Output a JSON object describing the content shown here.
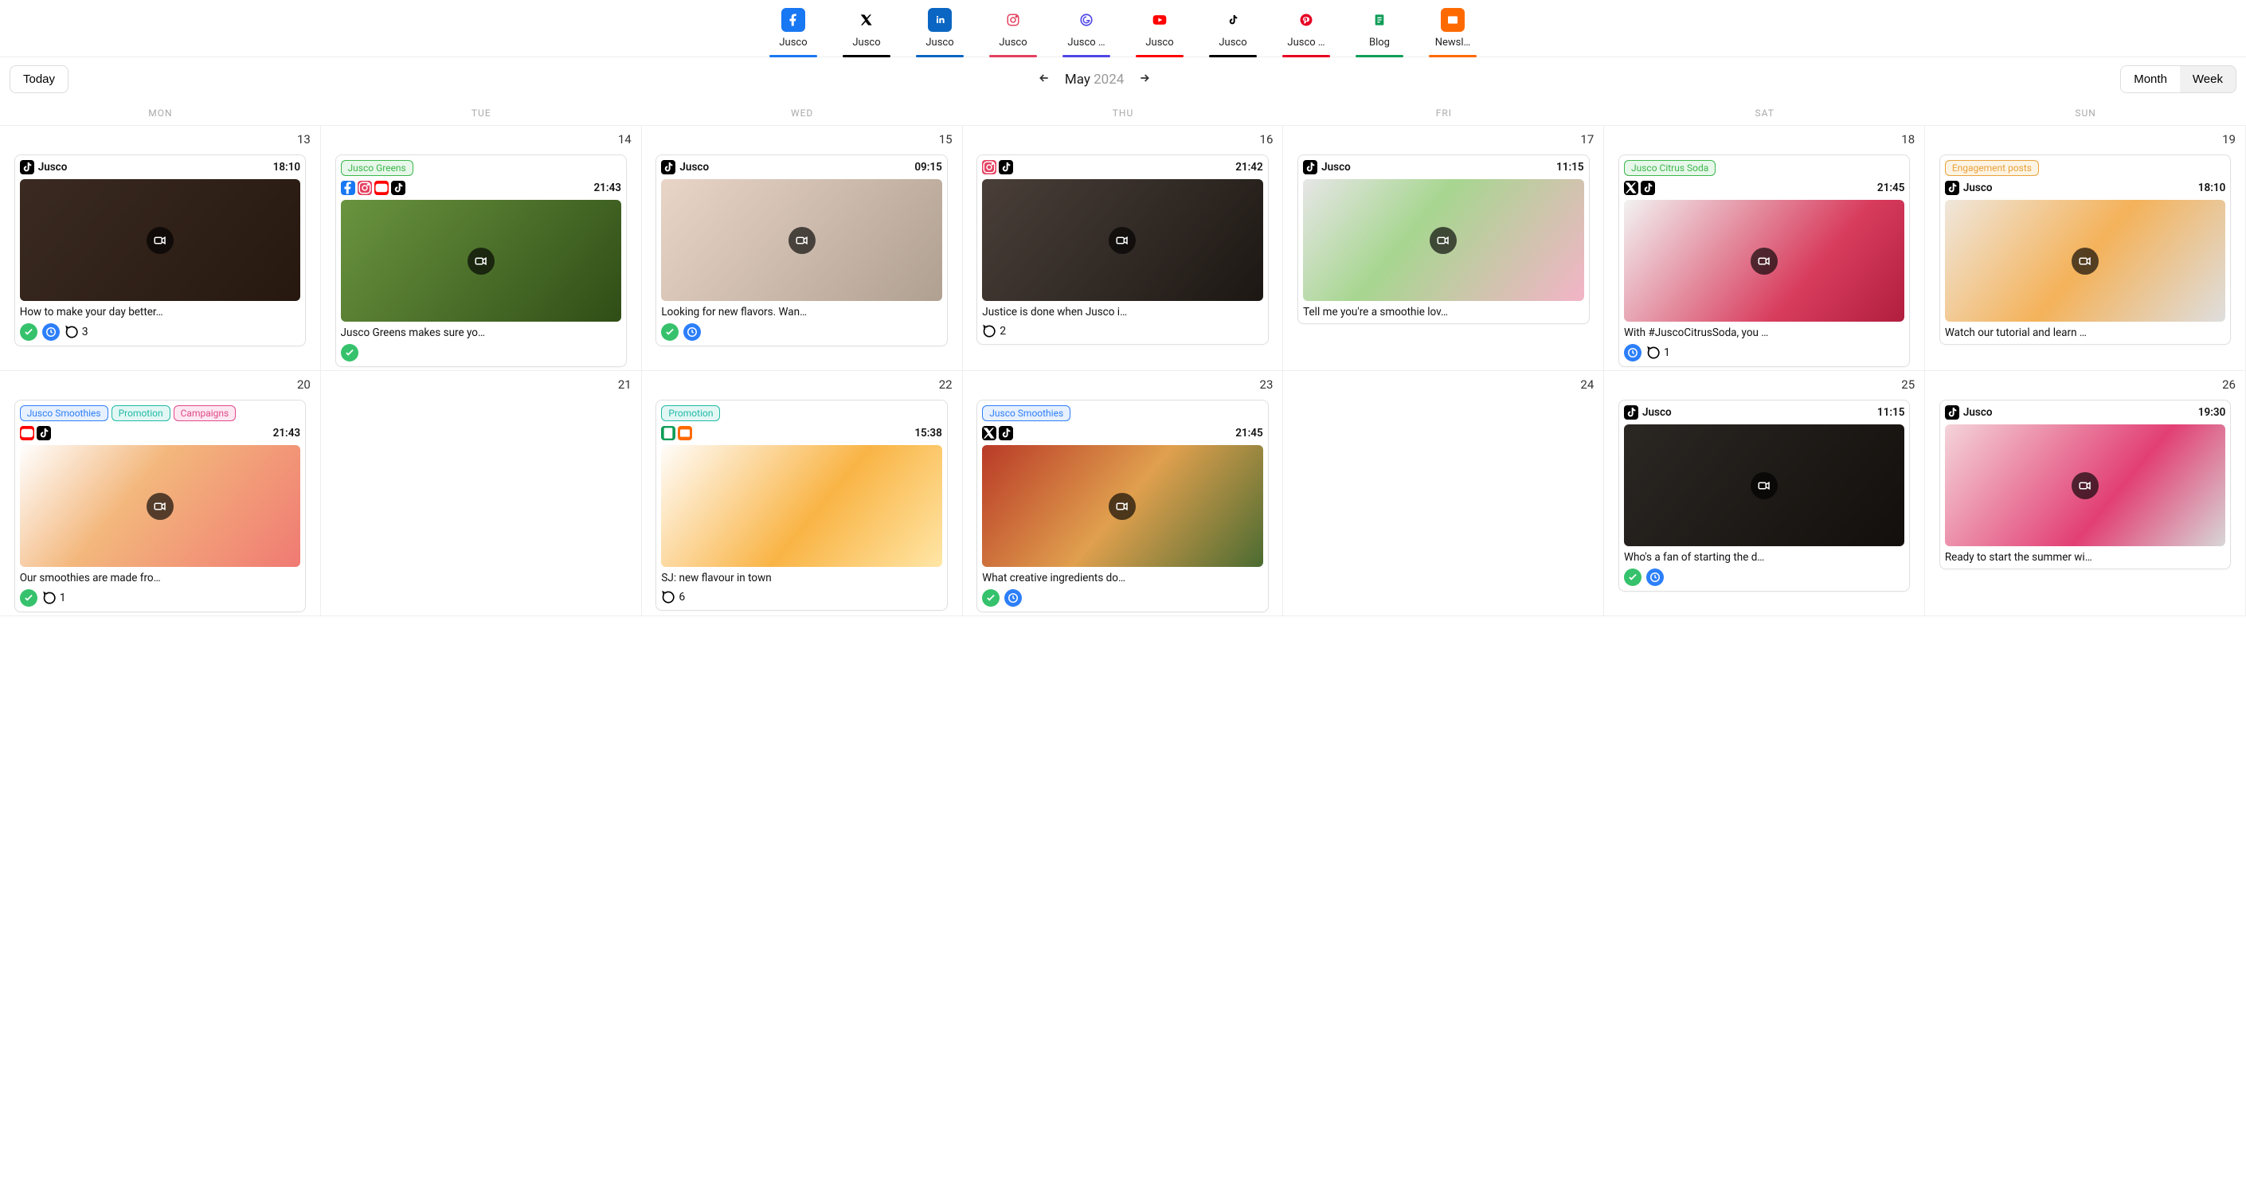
{
  "channels": [
    {
      "label": "Jusco",
      "icon": "facebook",
      "bg": "#1877F2",
      "fg": "#fff",
      "underline": "#1877F2"
    },
    {
      "label": "Jusco",
      "icon": "x",
      "bg": "#fff",
      "fg": "#000",
      "underline": "#000"
    },
    {
      "label": "Jusco",
      "icon": "linkedin",
      "bg": "#0A66C2",
      "fg": "#fff",
      "underline": "#0A66C2"
    },
    {
      "label": "Jusco",
      "icon": "instagram",
      "bg": "#fff",
      "fg": "#E4405F",
      "underline": "#E4405F"
    },
    {
      "label": "Jusco …",
      "icon": "google",
      "bg": "#fff",
      "fg": "#4F46E5",
      "underline": "#4F46E5"
    },
    {
      "label": "Jusco",
      "icon": "youtube",
      "bg": "#fff",
      "fg": "#FF0000",
      "underline": "#FF0000"
    },
    {
      "label": "Jusco",
      "icon": "tiktok",
      "bg": "#fff",
      "fg": "#000",
      "underline": "#000"
    },
    {
      "label": "Jusco …",
      "icon": "pinterest",
      "bg": "#fff",
      "fg": "#E60023",
      "underline": "#E60023"
    },
    {
      "label": "Blog",
      "icon": "doc",
      "bg": "#fff",
      "fg": "#0F9D58",
      "underline": "#0F9D58"
    },
    {
      "label": "Newsl…",
      "icon": "mail",
      "bg": "#FF6A00",
      "fg": "#fff",
      "underline": "#FF6A00"
    }
  ],
  "toolbar": {
    "today": "Today",
    "month": "May",
    "year": "2024",
    "view_month": "Month",
    "view_week": "Week"
  },
  "weekdays": [
    "MON",
    "TUE",
    "WED",
    "THU",
    "FRI",
    "SAT",
    "SUN"
  ],
  "week1_dates": [
    "13",
    "14",
    "15",
    "16",
    "17",
    "18",
    "19"
  ],
  "week2_dates": [
    "20",
    "21",
    "22",
    "23",
    "24",
    "25",
    "26"
  ],
  "tags": {
    "jusco_greens": {
      "label": "Jusco Greens",
      "color": "#3bb74b",
      "bg": "#e7f7ea"
    },
    "jusco_citrus": {
      "label": "Jusco Citrus Soda",
      "color": "#3bb74b",
      "bg": "#e7f7ea"
    },
    "engagement": {
      "label": "Engagement posts",
      "color": "#e9a13b",
      "bg": "#fdf4e3"
    },
    "jusco_smoothies": {
      "label": "Jusco Smoothies",
      "color": "#2d7ff9",
      "bg": "#e7f0fe"
    },
    "promotion": {
      "label": "Promotion",
      "color": "#20b9a7",
      "bg": "#e2f7f4"
    },
    "campaigns": {
      "label": "Campaigns",
      "color": "#e04a8a",
      "bg": "#fde7f1"
    }
  },
  "cards": {
    "c13": {
      "account": "Jusco",
      "channels": [
        "tiktok"
      ],
      "time": "18:10",
      "caption": "How to make your day better…",
      "thumb": "t-coffee",
      "video": true,
      "status": [
        "check",
        "clock"
      ],
      "comments": 3
    },
    "c14": {
      "tags": [
        "jusco_greens"
      ],
      "channels": [
        "facebook",
        "instagram",
        "youtube",
        "tiktok"
      ],
      "time": "21:43",
      "caption": "Jusco Greens makes sure yo…",
      "thumb": "t-green",
      "video": true,
      "status": [
        "check"
      ]
    },
    "c15": {
      "account": "Jusco",
      "channels": [
        "tiktok"
      ],
      "time": "09:15",
      "caption": "Looking for new flavors. Wan…",
      "thumb": "t-face",
      "video": true,
      "status": [
        "check",
        "clock"
      ]
    },
    "c16": {
      "channels": [
        "instagram",
        "tiktok"
      ],
      "time": "21:42",
      "caption": "Justice is done when Jusco i…",
      "thumb": "t-bar",
      "video": true,
      "comments": 2
    },
    "c17": {
      "account": "Jusco",
      "channels": [
        "tiktok"
      ],
      "time": "11:15",
      "caption": "Tell me you're a smoothie lov…",
      "thumb": "t-smoothie",
      "video": true
    },
    "c18": {
      "tags": [
        "jusco_citrus"
      ],
      "channels": [
        "x",
        "tiktok"
      ],
      "time": "21:45",
      "caption": "With #JuscoCitrusSoda, you …",
      "thumb": "t-citrus",
      "video": true,
      "status": [
        "clock"
      ],
      "comments": 1
    },
    "c19": {
      "tags": [
        "engagement"
      ],
      "account": "Jusco",
      "channels": [
        "tiktok"
      ],
      "time": "18:10",
      "caption": "Watch our tutorial and learn …",
      "thumb": "t-net",
      "video": true
    },
    "c20": {
      "tags": [
        "jusco_smoothies",
        "promotion",
        "campaigns"
      ],
      "channels": [
        "youtube",
        "tiktok"
      ],
      "time": "21:43",
      "caption": "Our smoothies are made fro…",
      "thumb": "t-grapefruit",
      "video": true,
      "status": [
        "check"
      ],
      "comments": 1
    },
    "c22": {
      "tags": [
        "promotion"
      ],
      "channels": [
        "doc",
        "mail"
      ],
      "time": "15:38",
      "caption": "SJ: new flavour in town",
      "thumb": "t-orangejuice",
      "comments": 6
    },
    "c23": {
      "tags": [
        "jusco_smoothies"
      ],
      "channels": [
        "x",
        "tiktok"
      ],
      "time": "21:45",
      "caption": "What creative ingredients do…",
      "thumb": "t-redgreen",
      "video": true,
      "status": [
        "check",
        "clock"
      ]
    },
    "c25": {
      "account": "Jusco",
      "channels": [
        "tiktok"
      ],
      "time": "11:15",
      "caption": "Who's a fan of starting the d…",
      "thumb": "t-darkbar",
      "video": true,
      "status": [
        "check",
        "clock"
      ]
    },
    "c26": {
      "account": "Jusco",
      "channels": [
        "tiktok"
      ],
      "time": "19:30",
      "caption": "Ready to start the summer wi…",
      "thumb": "t-pink",
      "video": true
    }
  }
}
